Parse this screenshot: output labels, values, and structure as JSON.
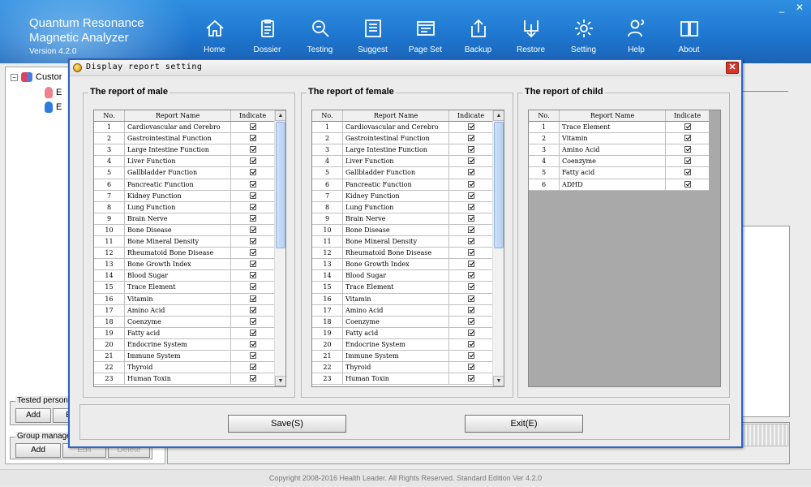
{
  "app": {
    "title_line1": "Quantum Resonance",
    "title_line2": "Magnetic Analyzer",
    "version": "Version 4.2.0"
  },
  "toolbar": [
    {
      "label": "Home",
      "icon": "home-icon"
    },
    {
      "label": "Dossier",
      "icon": "dossier-icon"
    },
    {
      "label": "Testing",
      "icon": "testing-icon"
    },
    {
      "label": "Suggest",
      "icon": "suggest-icon"
    },
    {
      "label": "Page Set",
      "icon": "page-set-icon"
    },
    {
      "label": "Backup",
      "icon": "backup-icon"
    },
    {
      "label": "Restore",
      "icon": "restore-icon"
    },
    {
      "label": "Setting",
      "icon": "gear-icon"
    },
    {
      "label": "Help",
      "icon": "help-icon"
    },
    {
      "label": "About",
      "icon": "about-icon"
    }
  ],
  "window_controls": {
    "minimize": "_",
    "close": "✕"
  },
  "tree": {
    "root_label": "Custor",
    "children": [
      "E",
      "E"
    ]
  },
  "tested_person": {
    "title": "Tested person ma",
    "add": "Add",
    "edit": "Ec"
  },
  "group_manage": {
    "title": "Group manage",
    "add": "Add",
    "edit": "Edit",
    "delete": "Delete"
  },
  "footer": "Copyright 2008-2016 Health Leader. All Rights Reserved.  Standard Edition Ver 4.2.0",
  "dialog": {
    "title": "Display report setting",
    "columns": {
      "no": "No.",
      "name": "Report Name",
      "indicate": "Indicate"
    },
    "male": {
      "title": "The report of male",
      "rows": [
        {
          "no": "1",
          "name": "Cardiovascular and Cerebro",
          "checked": true
        },
        {
          "no": "2",
          "name": "Gastrointestinal Function",
          "checked": true
        },
        {
          "no": "3",
          "name": "Large Intestine Function",
          "checked": true
        },
        {
          "no": "4",
          "name": "Liver Function",
          "checked": true
        },
        {
          "no": "5",
          "name": "Gallbladder Function",
          "checked": true
        },
        {
          "no": "6",
          "name": "Pancreatic Function",
          "checked": true
        },
        {
          "no": "7",
          "name": "Kidney Function",
          "checked": true
        },
        {
          "no": "8",
          "name": "Lung Function",
          "checked": true
        },
        {
          "no": "9",
          "name": "Brain Nerve",
          "checked": true
        },
        {
          "no": "10",
          "name": "Bone Disease",
          "checked": true
        },
        {
          "no": "11",
          "name": "Bone Mineral Density",
          "checked": true
        },
        {
          "no": "12",
          "name": "Rheumatoid Bone Disease",
          "checked": true
        },
        {
          "no": "13",
          "name": "Bone Growth Index",
          "checked": true
        },
        {
          "no": "14",
          "name": "Blood Sugar",
          "checked": true
        },
        {
          "no": "15",
          "name": "Trace Element",
          "checked": true
        },
        {
          "no": "16",
          "name": "Vitamin",
          "checked": true
        },
        {
          "no": "17",
          "name": "Amino Acid",
          "checked": true
        },
        {
          "no": "18",
          "name": "Coenzyme",
          "checked": true
        },
        {
          "no": "19",
          "name": "Fatty acid",
          "checked": true
        },
        {
          "no": "20",
          "name": "Endocrine System",
          "checked": true
        },
        {
          "no": "21",
          "name": "Immune System",
          "checked": true
        },
        {
          "no": "22",
          "name": "Thyroid",
          "checked": true
        },
        {
          "no": "23",
          "name": "Human Toxin",
          "checked": true
        }
      ]
    },
    "female": {
      "title": "The report of female",
      "rows": [
        {
          "no": "1",
          "name": "Cardiovascular and Cerebro",
          "checked": true
        },
        {
          "no": "2",
          "name": "Gastrointestinal Function",
          "checked": true
        },
        {
          "no": "3",
          "name": "Large Intestine Function",
          "checked": true
        },
        {
          "no": "4",
          "name": "Liver Function",
          "checked": true
        },
        {
          "no": "5",
          "name": "Gallbladder Function",
          "checked": true
        },
        {
          "no": "6",
          "name": "Pancreatic Function",
          "checked": true
        },
        {
          "no": "7",
          "name": "Kidney Function",
          "checked": true
        },
        {
          "no": "8",
          "name": "Lung Function",
          "checked": true
        },
        {
          "no": "9",
          "name": "Brain Nerve",
          "checked": true
        },
        {
          "no": "10",
          "name": "Bone Disease",
          "checked": true
        },
        {
          "no": "11",
          "name": "Bone Mineral Density",
          "checked": true
        },
        {
          "no": "12",
          "name": "Rheumatoid Bone Disease",
          "checked": true
        },
        {
          "no": "13",
          "name": "Bone Growth Index",
          "checked": true
        },
        {
          "no": "14",
          "name": "Blood Sugar",
          "checked": true
        },
        {
          "no": "15",
          "name": "Trace Element",
          "checked": true
        },
        {
          "no": "16",
          "name": "Vitamin",
          "checked": true
        },
        {
          "no": "17",
          "name": "Amino Acid",
          "checked": true
        },
        {
          "no": "18",
          "name": "Coenzyme",
          "checked": true
        },
        {
          "no": "19",
          "name": "Fatty acid",
          "checked": true
        },
        {
          "no": "20",
          "name": "Endocrine System",
          "checked": true
        },
        {
          "no": "21",
          "name": "Immune System",
          "checked": true
        },
        {
          "no": "22",
          "name": "Thyroid",
          "checked": true
        },
        {
          "no": "23",
          "name": "Human Toxin",
          "checked": true
        }
      ]
    },
    "child": {
      "title": "The report of child",
      "rows": [
        {
          "no": "1",
          "name": "Trace Element",
          "checked": true
        },
        {
          "no": "2",
          "name": "Vitamin",
          "checked": true
        },
        {
          "no": "3",
          "name": "Amino Acid",
          "checked": true
        },
        {
          "no": "4",
          "name": "Coenzyme",
          "checked": true
        },
        {
          "no": "5",
          "name": "Fatty acid",
          "checked": true
        },
        {
          "no": "6",
          "name": "ADHD",
          "checked": true
        }
      ]
    },
    "save_label": "Save(S)",
    "exit_label": "Exit(E)"
  },
  "colors": {
    "header": "#1f77d0",
    "dialog_border": "#2a62c8",
    "close_button": "#d5352a",
    "child_grid_bg": "#a9a9a9"
  }
}
